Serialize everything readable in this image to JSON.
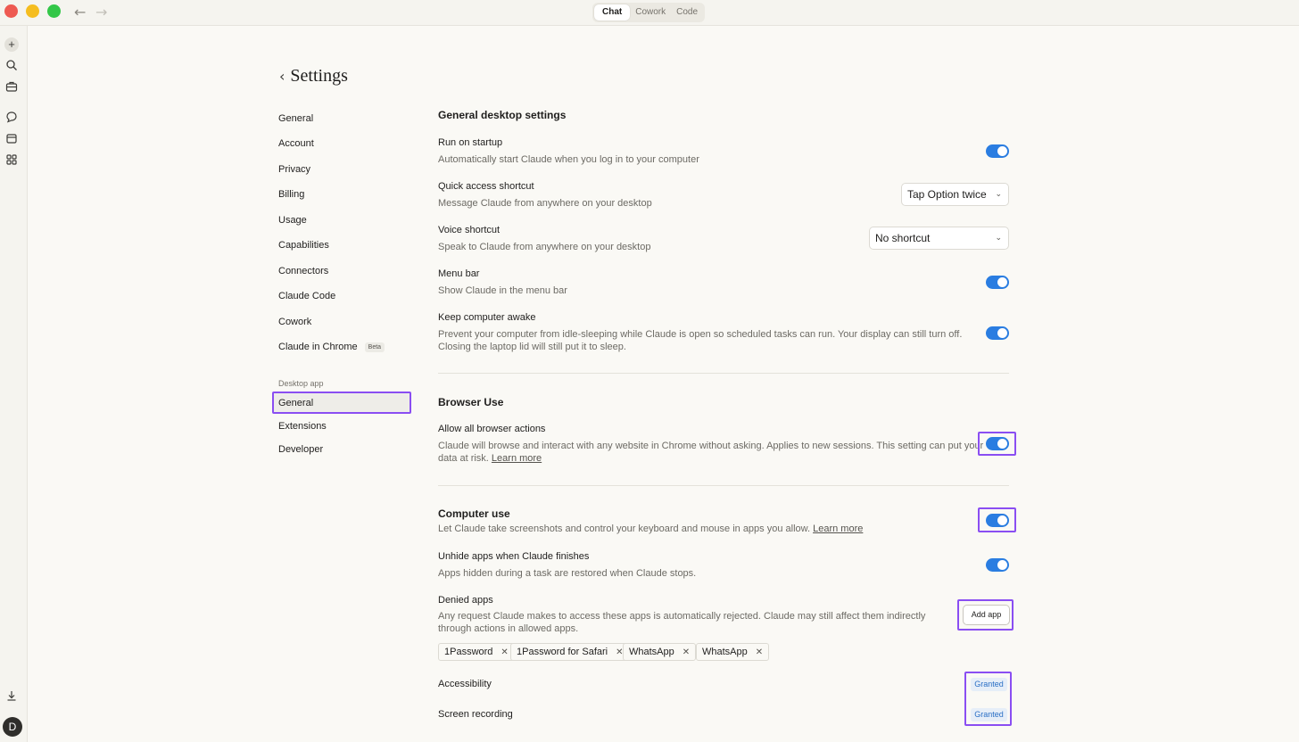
{
  "titlebar": {
    "modes": [
      "Chat",
      "Cowork",
      "Code"
    ],
    "active_mode": "Chat"
  },
  "rail": {
    "icons": [
      "plus-icon",
      "search-icon",
      "briefcase-icon",
      "chat-bubble-icon",
      "archive-icon",
      "apps-grid-icon",
      "download-icon"
    ],
    "avatar_initial": "D"
  },
  "settings": {
    "title": "Settings",
    "nav": {
      "items": [
        "General",
        "Account",
        "Privacy",
        "Billing",
        "Usage",
        "Capabilities",
        "Connectors",
        "Claude Code",
        "Cowork",
        "Claude in Chrome"
      ],
      "beta_badge": "Beta",
      "section_label": "Desktop app",
      "desktop_items": [
        "General",
        "Extensions",
        "Developer"
      ],
      "active_item": "General"
    }
  },
  "main": {
    "general_desktop": {
      "heading": "General desktop settings",
      "run_on_startup": {
        "title": "Run on startup",
        "desc": "Automatically start Claude when you log in to your computer",
        "enabled": true
      },
      "quick_access": {
        "title": "Quick access shortcut",
        "desc": "Message Claude from anywhere on your desktop",
        "value": "Tap Option twice"
      },
      "voice_shortcut": {
        "title": "Voice shortcut",
        "desc": "Speak to Claude from anywhere on your desktop",
        "value": "No shortcut"
      },
      "menu_bar": {
        "title": "Menu bar",
        "desc": "Show Claude in the menu bar",
        "enabled": true
      },
      "keep_awake": {
        "title": "Keep computer awake",
        "desc_line1": "Prevent your computer from idle-sleeping while Claude is open so scheduled tasks can run. Your display can still turn off.",
        "desc_line2": "Closing the laptop lid will still put it to sleep.",
        "enabled": true
      }
    },
    "browser_use": {
      "heading": "Browser Use",
      "allow_all": {
        "title": "Allow all browser actions",
        "desc_line1": "Claude will browse and interact with any website in Chrome without asking. Applies to new sessions. This setting can put your",
        "desc_line2_prefix": "data at risk.",
        "learn_more": "Learn more",
        "enabled": true
      }
    },
    "computer_use": {
      "heading": "Computer use",
      "desc_prefix": "Let Claude take screenshots and control your keyboard and mouse in apps you allow.",
      "learn_more": "Learn more",
      "enabled": true,
      "unhide": {
        "title": "Unhide apps when Claude finishes",
        "desc": "Apps hidden during a task are restored when Claude stops.",
        "enabled": true
      },
      "denied": {
        "title": "Denied apps",
        "desc_line1": "Any request Claude makes to access these apps is automatically rejected. Claude may still affect them indirectly",
        "desc_line2": "through actions in allowed apps.",
        "add_button": "Add app",
        "apps": [
          "1Password",
          "1Password for Safari",
          "WhatsApp",
          "WhatsApp"
        ]
      },
      "permissions": [
        {
          "name": "Accessibility",
          "status": "Granted"
        },
        {
          "name": "Screen recording",
          "status": "Granted"
        }
      ]
    }
  },
  "colors": {
    "accent_toggle": "#2a7de1",
    "highlight": "#8a4ef2",
    "granted_text": "#2a6fc5"
  }
}
